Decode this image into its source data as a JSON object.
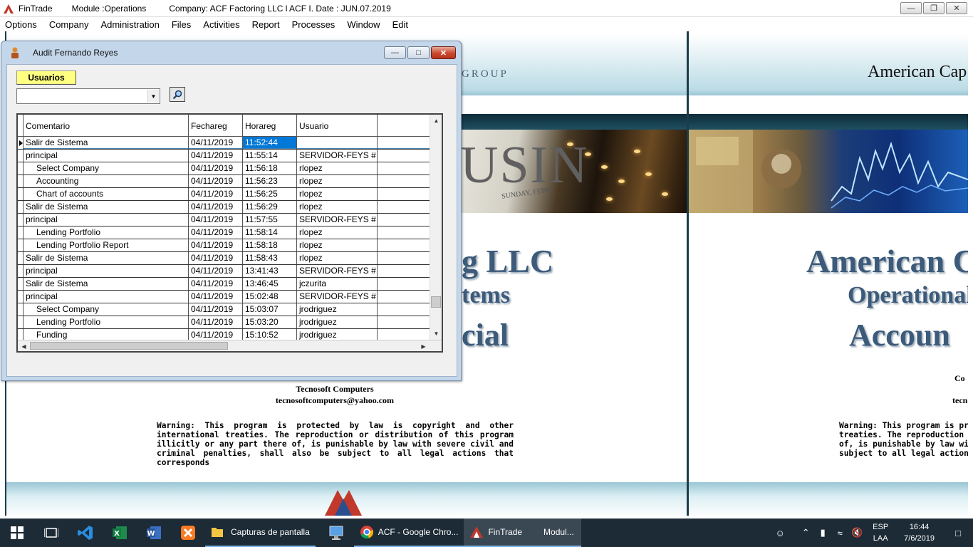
{
  "app": {
    "name": "FinTrade",
    "module": "Module :Operations",
    "company": "Company: ACF Factoring LLC l ACF I. Date : JUN.07.2019"
  },
  "menu": [
    "Options",
    "Company",
    "Administration",
    "Files",
    "Activities",
    "Report",
    "Processes",
    "Window",
    "Edit"
  ],
  "background": {
    "group_text": "GROUP",
    "american_top": "American Cap",
    "photo_word": "USIN",
    "photo_sub": "SUNDAY, FEBR",
    "company_line": "g LLC",
    "systems_line": "tems",
    "financial_line": "cial",
    "right_line1": "American Ca",
    "right_line2": "Operational A",
    "right_line3": "Accoun",
    "vendor": "Tecnosoft Computers",
    "email": "tecnosoftcomputers@yahoo.com",
    "right_cop": "Co",
    "right_tecn": "tecn",
    "warning": "Warning: This program is protected by law is copyright and other international treaties. The reproduction or distribution of this program illicitly or any part there of, is punishable by law with severe civil and criminal penalties, shall also be subject to all legal actions that corresponds",
    "warning_right": [
      "Warning: This program is pro",
      "treaties. The reproduction or d",
      "of, is punishable by law with",
      "subject to all legal actions th"
    ]
  },
  "dialog": {
    "title": "Audit Fernando Reyes",
    "tab_label": "Usuarios",
    "combo_value": "",
    "columns": [
      "Comentario",
      "Fechareg",
      "Horareg",
      "Usuario",
      ""
    ],
    "rows": [
      {
        "comentario": "Salir de Sistema",
        "fecha": "04/11/2019",
        "hora": "11:52:44",
        "usuario": "",
        "indent": false,
        "current": true
      },
      {
        "comentario": "principal",
        "fecha": "04/11/2019",
        "hora": "11:55:14",
        "usuario": "SERVIDOR-FEYS #",
        "indent": false
      },
      {
        "comentario": "Select Company",
        "fecha": "04/11/2019",
        "hora": "11:56:18",
        "usuario": "rlopez",
        "indent": true
      },
      {
        "comentario": "Accounting",
        "fecha": "04/11/2019",
        "hora": "11:56:23",
        "usuario": "rlopez",
        "indent": true
      },
      {
        "comentario": "Chart of accounts",
        "fecha": "04/11/2019",
        "hora": "11:56:25",
        "usuario": "rlopez",
        "indent": true
      },
      {
        "comentario": "Salir de Sistema",
        "fecha": "04/11/2019",
        "hora": "11:56:29",
        "usuario": "rlopez",
        "indent": false
      },
      {
        "comentario": "principal",
        "fecha": "04/11/2019",
        "hora": "11:57:55",
        "usuario": "SERVIDOR-FEYS #",
        "indent": false
      },
      {
        "comentario": "Lending Portfolio",
        "fecha": "04/11/2019",
        "hora": "11:58:14",
        "usuario": "rlopez",
        "indent": true
      },
      {
        "comentario": "Lending Portfolio Report",
        "fecha": "04/11/2019",
        "hora": "11:58:18",
        "usuario": "rlopez",
        "indent": true
      },
      {
        "comentario": "Salir de Sistema",
        "fecha": "04/11/2019",
        "hora": "11:58:43",
        "usuario": "rlopez",
        "indent": false
      },
      {
        "comentario": "principal",
        "fecha": "04/11/2019",
        "hora": "13:41:43",
        "usuario": "SERVIDOR-FEYS #",
        "indent": false
      },
      {
        "comentario": "Salir de Sistema",
        "fecha": "04/11/2019",
        "hora": "13:46:45",
        "usuario": "jczurita",
        "indent": false
      },
      {
        "comentario": "principal",
        "fecha": "04/11/2019",
        "hora": "15:02:48",
        "usuario": "SERVIDOR-FEYS #",
        "indent": false
      },
      {
        "comentario": "Select Company",
        "fecha": "04/11/2019",
        "hora": "15:03:07",
        "usuario": "jrodriguez",
        "indent": true
      },
      {
        "comentario": "Lending Portfolio",
        "fecha": "04/11/2019",
        "hora": "15:03:20",
        "usuario": "jrodriguez",
        "indent": true
      },
      {
        "comentario": "Funding",
        "fecha": "04/11/2019",
        "hora": "15:10:52",
        "usuario": "jrodriguez",
        "indent": true
      }
    ]
  },
  "taskbar": {
    "apps": [
      {
        "name": "file-explorer",
        "label": "Capturas de pantalla"
      },
      {
        "name": "chrome",
        "label": "ACF - Google Chro..."
      },
      {
        "name": "fintrade",
        "label": "FinTrade"
      },
      {
        "name": "module",
        "label": "Modul..."
      }
    ],
    "lang": "ESP",
    "lang_sub": "LAA",
    "time": "16:44",
    "date": "7/6/2019"
  },
  "colors": {
    "taskbar": "#1c2b36",
    "dialog_frame": "#c3d6ea",
    "selection": "#0078d7",
    "tab_yellow": "#ffff80",
    "brand_blue": "#3c5a7a"
  }
}
